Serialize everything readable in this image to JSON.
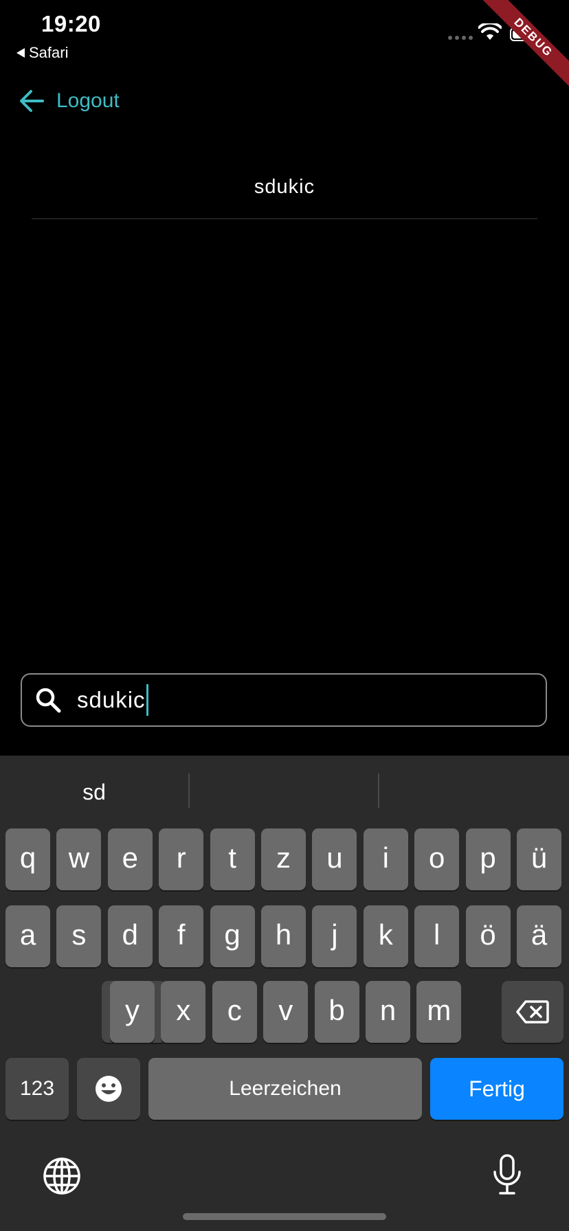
{
  "status": {
    "time": "19:20",
    "back_label": "Safari"
  },
  "debug_banner": "DEBUG",
  "header": {
    "logout_label": "Logout"
  },
  "result": {
    "username": "sdukic"
  },
  "search": {
    "value": "sdukic"
  },
  "keyboard": {
    "suggestions": [
      "sd",
      "",
      ""
    ],
    "row1": [
      "q",
      "w",
      "e",
      "r",
      "t",
      "z",
      "u",
      "i",
      "o",
      "p",
      "ü"
    ],
    "row2": [
      "a",
      "s",
      "d",
      "f",
      "g",
      "h",
      "j",
      "k",
      "l",
      "ö",
      "ä"
    ],
    "row3": [
      "y",
      "x",
      "c",
      "v",
      "b",
      "n",
      "m"
    ],
    "numbers_label": "123",
    "space_label": "Leerzeichen",
    "done_label": "Fertig"
  },
  "colors": {
    "accent": "#3fbcc4",
    "keyboard_bg": "#2b2b2b",
    "key": "#6b6b6b",
    "done_key": "#0a84ff"
  }
}
